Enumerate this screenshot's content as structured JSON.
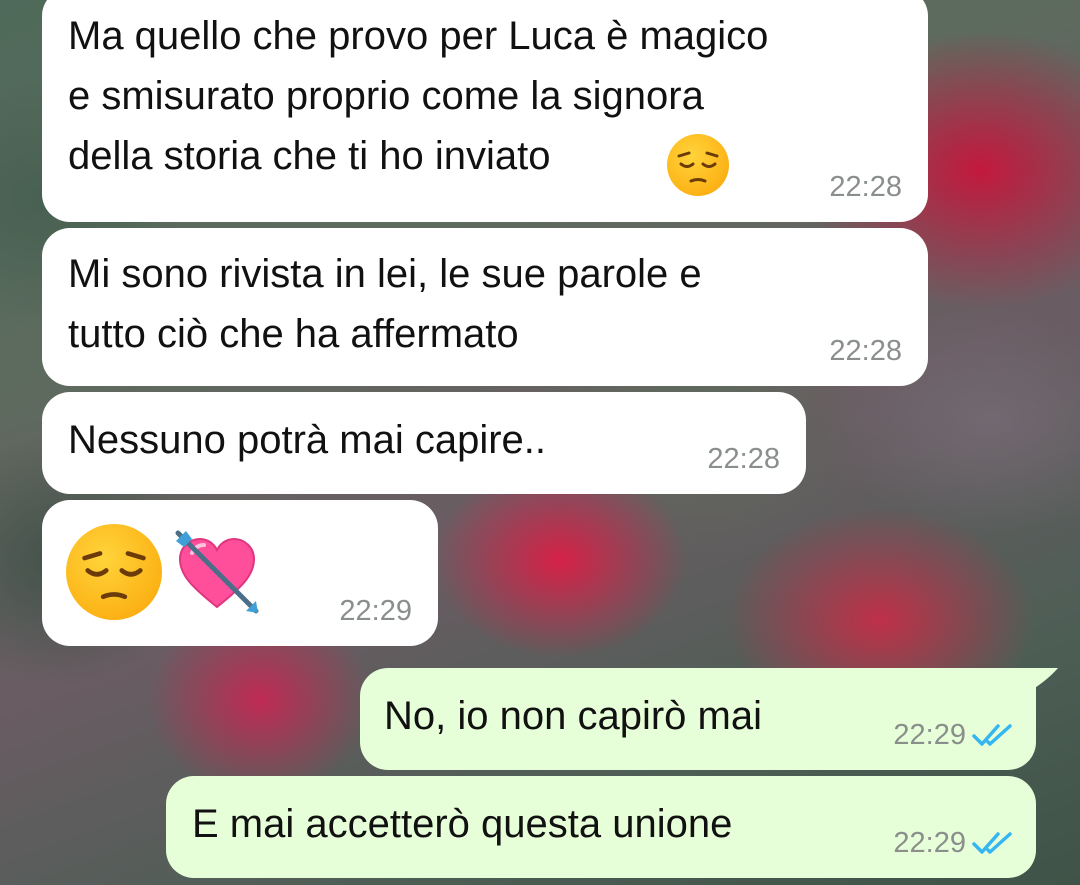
{
  "colors": {
    "incoming_bubble": "#ffffff",
    "outgoing_bubble": "#e7ffd9",
    "timestamp": "#8a8f8c",
    "read_ticks": "#34b7f1"
  },
  "messages": [
    {
      "direction": "incoming",
      "text": "Ma quello che provo per Luca è magico\ne smisurato proprio come la signora\ndella storia che ti ho inviato",
      "emoji": "pensive-face",
      "time": "22:28"
    },
    {
      "direction": "incoming",
      "text": "Mi sono rivista in lei, le sue parole e\ntutto ciò che ha affermato",
      "time": "22:28"
    },
    {
      "direction": "incoming",
      "text": "Nessuno potrà mai capire..",
      "time": "22:28"
    },
    {
      "direction": "incoming",
      "emoji_only": [
        "pensive-face",
        "heart-with-arrow"
      ],
      "time": "22:29"
    },
    {
      "direction": "outgoing",
      "text": "No, io non capirò mai",
      "time": "22:29",
      "status_icon": "double-check-read-icon"
    },
    {
      "direction": "outgoing",
      "text": "E mai accetterò questa unione",
      "time": "22:29",
      "status_icon": "double-check-read-icon"
    }
  ]
}
